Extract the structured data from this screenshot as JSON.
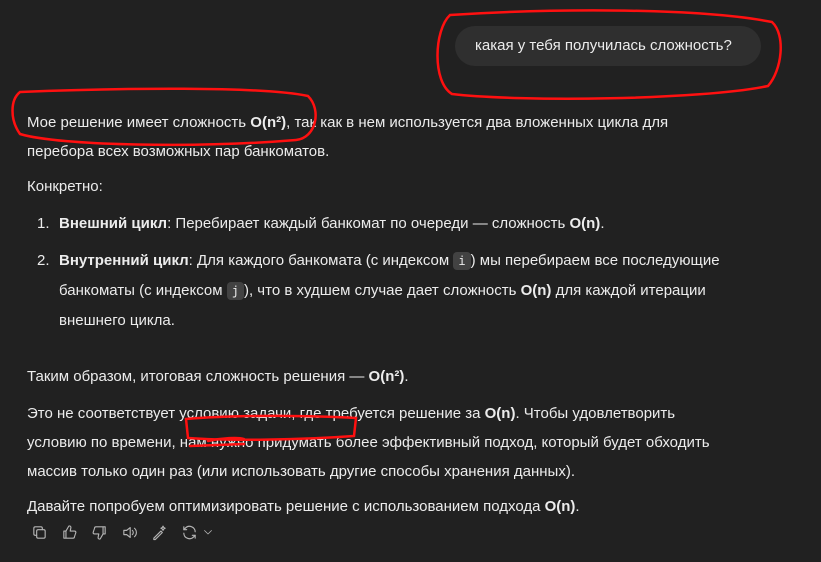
{
  "user_message": "какая у тебя получилась сложность?",
  "assistant": {
    "p1_a": "Мое решение имеет сложность ",
    "p1_b": "O(n²)",
    "p1_c": ", так как в нем используется два вложенных цикла для",
    "p1_d": "перебора всех возможных пар банкоматов.",
    "p2": "Конкретно:",
    "li1_num": "1.",
    "li1_bold": "Внешний цикл",
    "li1_text": ": Перебирает каждый банкомат по очереди — сложность ",
    "li1_o": "O(n)",
    "li1_end": ".",
    "li2_num": "2.",
    "li2_bold": "Внутренний цикл",
    "li2_t1": ": Для каждого банкомата (с индексом ",
    "li2_code1": "i",
    "li2_t2": ") мы перебираем все последующие",
    "li2_t3": "банкоматы (с индексом ",
    "li2_code2": "j",
    "li2_t4": "), что в худшем случае дает сложность ",
    "li2_o": "O(n)",
    "li2_t5": " для каждой итерации",
    "li2_t6": "внешнего цикла.",
    "p3_a": "Таким образом, итоговая сложность решения — ",
    "p3_b": "O(n²)",
    "p3_c": ".",
    "p4_a": "Это не соответствует условию задачи, где требуется решение за ",
    "p4_b": "O(n)",
    "p4_c": ". Чтобы удовлетворить",
    "p4_d": "условию по времени, нам нужно придумать более эффективный подход, который будет обходить",
    "p4_e": "массив только один раз (или использовать другие способы хранения данных).",
    "p5_a": "Давайте попробуем оптимизировать решение с использованием подхода ",
    "p5_b": "O(n)",
    "p5_c": "."
  },
  "toolbar": {
    "icons": [
      "copy-icon",
      "thumbs-up-icon",
      "thumbs-down-icon",
      "speaker-icon",
      "edit-sparkle-icon",
      "regenerate-icon"
    ]
  },
  "colors": {
    "background": "#212121",
    "text": "#ececec",
    "bubble": "#2f2f2f",
    "annotation": "#ff1010"
  }
}
